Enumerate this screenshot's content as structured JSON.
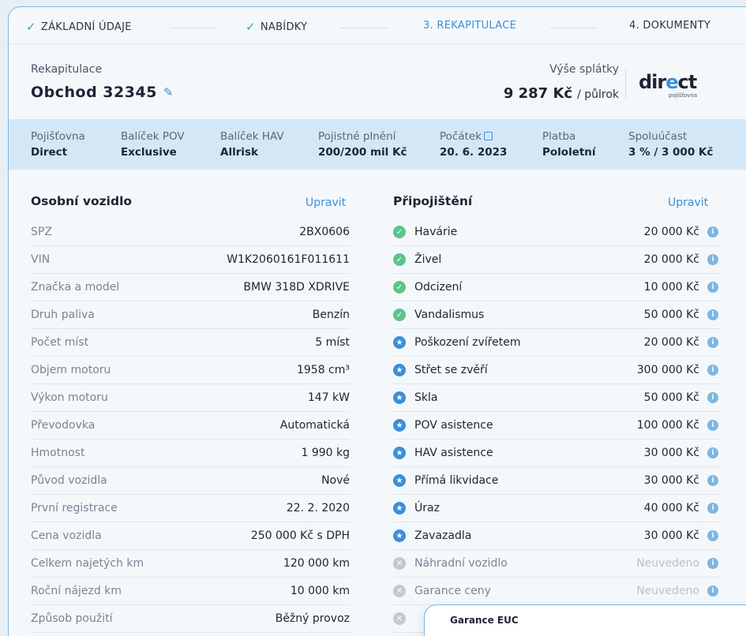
{
  "steps": [
    {
      "label": "ZÁKLADNÍ ÚDAJE",
      "state": "done"
    },
    {
      "label": "NABÍDKY",
      "state": "done"
    },
    {
      "label": "3. REKAPITULACE",
      "state": "active"
    },
    {
      "label": "4. DOKUMENTY",
      "state": "todo"
    }
  ],
  "header": {
    "subtitle": "Rekapitulace",
    "title": "Obchod 32345",
    "payment_label": "Výše splátky",
    "payment_amount": "9 287 Kč",
    "payment_period": "/ půlrok",
    "logo_word_a": "dir",
    "logo_word_b": "e",
    "logo_word_c": "ct",
    "logo_sub": "pojišťovna"
  },
  "summary": [
    {
      "label": "Pojišťovna",
      "value": "Direct"
    },
    {
      "label": "Balíček POV",
      "value": "Exclusive"
    },
    {
      "label": "Balíček HAV",
      "value": "Allrisk"
    },
    {
      "label": "Pojistné plnění",
      "value": "200/200 mil Kč"
    },
    {
      "label": "Počátek",
      "value": "20. 6. 2023"
    },
    {
      "label": "Platba",
      "value": "Pololetní"
    },
    {
      "label": "Spoluúčast",
      "value": "3 % / 3 000 Kč"
    }
  ],
  "vehicle": {
    "title": "Osobní vozidlo",
    "edit_label": "Upravit",
    "rows": [
      {
        "label": "SPZ",
        "value": "2BX0606"
      },
      {
        "label": "VIN",
        "value": "W1K2060161F011611"
      },
      {
        "label": "Značka a model",
        "value": "BMW 318D XDRIVE"
      },
      {
        "label": "Druh paliva",
        "value": "Benzín"
      },
      {
        "label": "Počet míst",
        "value": "5 míst"
      },
      {
        "label": "Objem motoru",
        "value": "1958 cm³"
      },
      {
        "label": "Výkon motoru",
        "value": "147 kW"
      },
      {
        "label": "Převodovka",
        "value": "Automatická"
      },
      {
        "label": "Hmotnost",
        "value": "1 990 kg"
      },
      {
        "label": "Původ vozidla",
        "value": "Nové"
      },
      {
        "label": "První registrace",
        "value": "22. 2. 2020"
      },
      {
        "label": "Cena vozidla",
        "value": "250 000 Kč s DPH"
      },
      {
        "label": "Celkem najetých km",
        "value": "120 000 km"
      },
      {
        "label": "Roční nájezd km",
        "value": "10 000 km"
      },
      {
        "label": "Způsob použití",
        "value": "Běžný provoz"
      }
    ]
  },
  "coverage": {
    "title": "Připojištění",
    "edit_label": "Upravit",
    "rows": [
      {
        "label": "Havárie",
        "value": "20 000 Kč",
        "status": "ok"
      },
      {
        "label": "Živel",
        "value": "20 000 Kč",
        "status": "ok"
      },
      {
        "label": "Odcizení",
        "value": "10 000 Kč",
        "status": "ok"
      },
      {
        "label": "Vandalismus",
        "value": "50 000 Kč",
        "status": "ok"
      },
      {
        "label": "Poškození zvířetem",
        "value": "20 000 Kč",
        "status": "star"
      },
      {
        "label": "Střet se zvěří",
        "value": "300 000 Kč",
        "status": "star"
      },
      {
        "label": "Skla",
        "value": "50 000 Kč",
        "status": "star"
      },
      {
        "label": "POV asistence",
        "value": "100 000 Kč",
        "status": "star"
      },
      {
        "label": "HAV asistence",
        "value": "30 000 Kč",
        "status": "star"
      },
      {
        "label": "Přímá likvidace",
        "value": "30 000 Kč",
        "status": "star"
      },
      {
        "label": "Úraz",
        "value": "40 000 Kč",
        "status": "star"
      },
      {
        "label": "Zavazadla",
        "value": "30 000 Kč",
        "status": "star"
      },
      {
        "label": "Náhradní vozidlo",
        "value": "Neuvedeno",
        "status": "no"
      },
      {
        "label": "Garance ceny",
        "value": "Neuvedeno",
        "status": "no"
      },
      {
        "label": "",
        "value": "",
        "status": "no"
      }
    ]
  },
  "popup": {
    "title": "Garance EUC"
  },
  "colors": {
    "accent": "#3b8fd8",
    "ok": "#5cc48a",
    "band": "#d3e7f6",
    "border": "#7fb6e0"
  }
}
